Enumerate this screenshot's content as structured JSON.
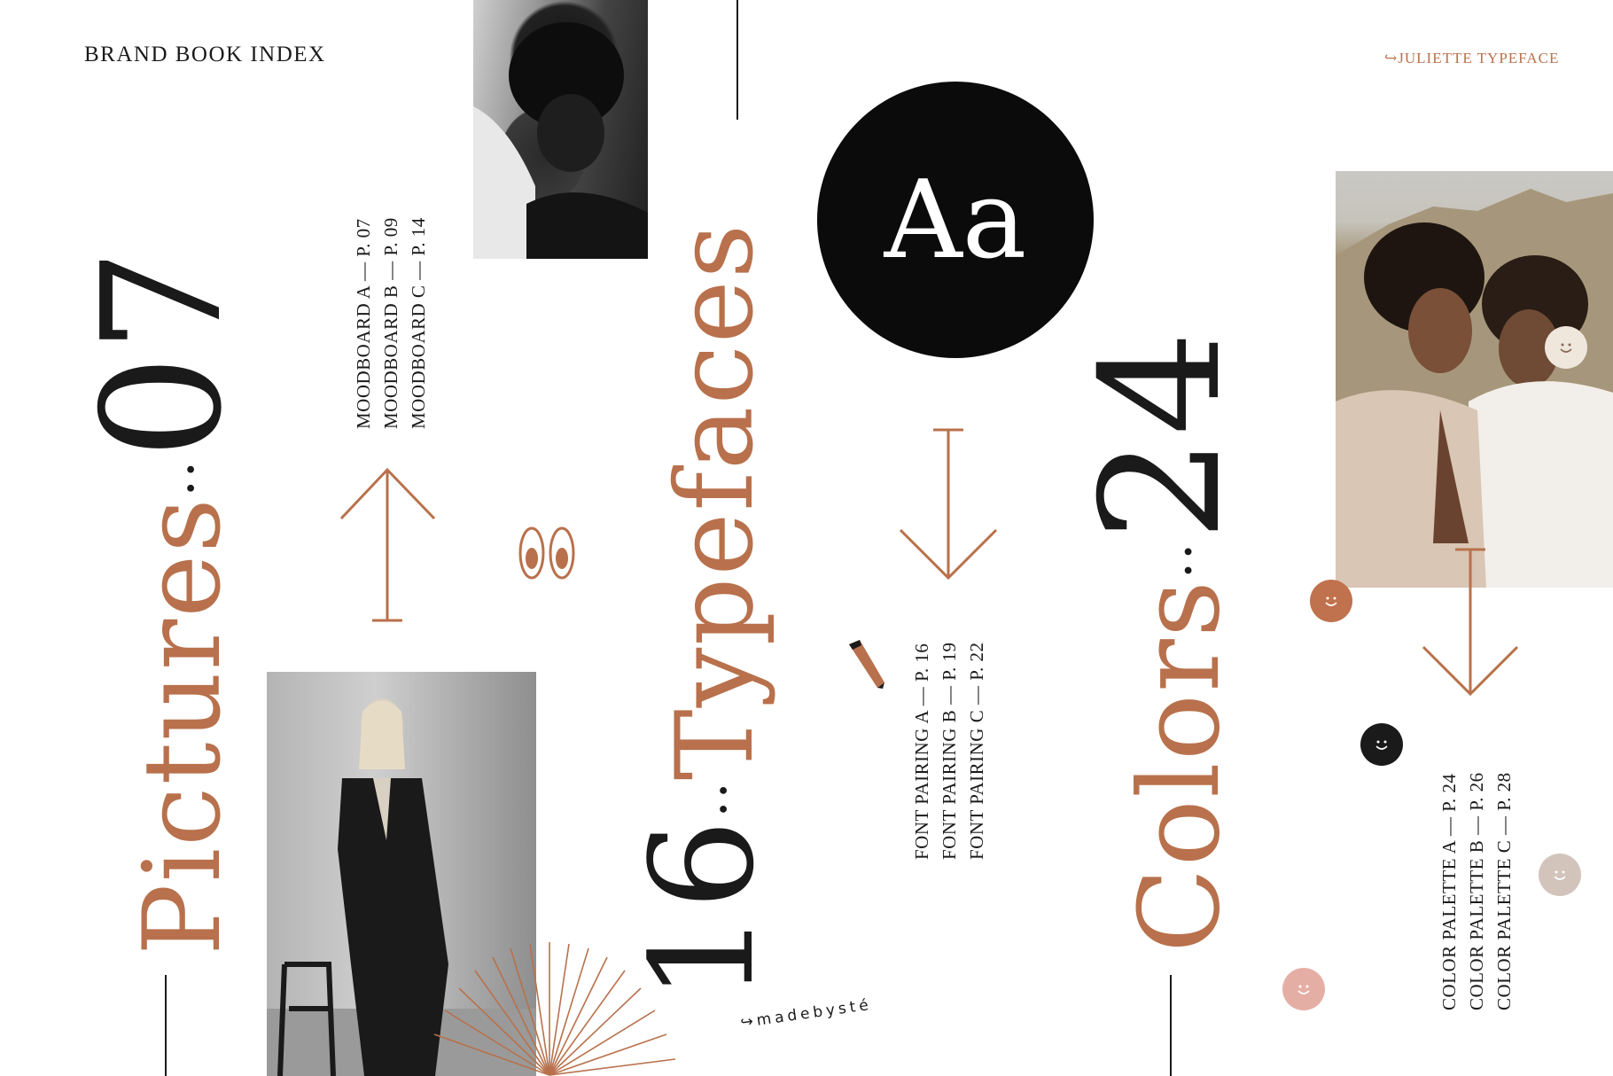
{
  "header": {
    "left_title": "BRAND BOOK INDEX",
    "right_title": "JULIETTE TYPEFACE",
    "right_arrow": "↪"
  },
  "sections": {
    "pictures": {
      "word": "Pictures",
      "separator": "··",
      "number": "07"
    },
    "typefaces": {
      "word": "Typefaces",
      "separator": "··",
      "number": "16"
    },
    "colors": {
      "word": "Colors",
      "separator": "··",
      "number": "24"
    }
  },
  "moodboard_list": [
    "MOODBOARD A — P. 07",
    "MOODBOARD B — P. 09",
    "MOODBOARD C — P. 14"
  ],
  "font_pairing_list": [
    "FONT PAIRING A — P. 16",
    "FONT PAIRING B — P. 19",
    "FONT PAIRING C — P. 22"
  ],
  "color_palette_list": [
    "COLOR PALETTE A — P. 24",
    "COLOR PALETTE B — P. 26",
    "COLOR PALETTE C — P. 28"
  ],
  "specimen": {
    "text": "Aa"
  },
  "signature": "madebysté",
  "icons": [
    "up-arrow-icon",
    "down-arrow-icon",
    "eyes-icon",
    "pencil-icon",
    "smiley-icon",
    "sunburst-icon"
  ],
  "colors": {
    "dark": "#1a1a1a",
    "rust": "#b8714c",
    "smiley_rust": "#c0714d",
    "smiley_black": "#1a1a1a",
    "smiley_cream": "#efe6dc",
    "smiley_taupe": "#d2c4bb",
    "smiley_pink": "#e5aea5"
  }
}
